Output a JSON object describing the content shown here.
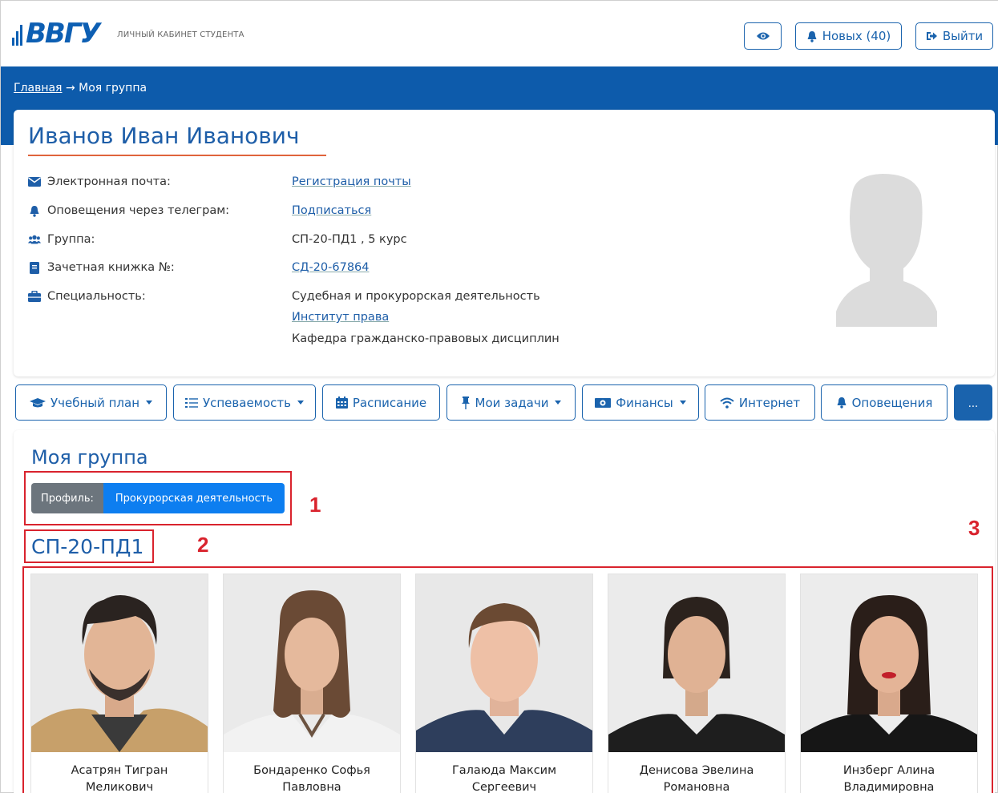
{
  "header": {
    "logo_text": "ВВГУ",
    "subtitle": "ЛИЧНЫЙ КАБИНЕТ СТУДЕНТА",
    "eye_icon": "eye-icon",
    "notifications_label": "Новых (40)",
    "logout_label": "Выйти"
  },
  "breadcrumb": {
    "home": "Главная",
    "arrow": "→",
    "current": "Моя группа"
  },
  "profile": {
    "name": "Иванов Иван Иванович",
    "rows": [
      {
        "icon": "envelope-icon",
        "label": "Электронная почта:",
        "value": "Регистрация почты"
      },
      {
        "icon": "bell-icon",
        "label": "Оповещения через телеграм:",
        "value": "Подписаться"
      },
      {
        "icon": "users-icon",
        "label": "Группа:",
        "value": "СП-20-ПД1 , 5 курс"
      },
      {
        "icon": "book-icon",
        "label": "Зачетная книжка №:",
        "value": "СД-20-67864"
      },
      {
        "icon": "briefcase-icon",
        "label": "Специальность:",
        "value": "Судебная и прокурорская деятельность"
      }
    ],
    "institute": "Институт права",
    "department": "Кафедра гражданско-правовых дисциплин"
  },
  "nav": [
    {
      "icon": "graduation-cap-icon",
      "label": "Учебный план",
      "dropdown": true
    },
    {
      "icon": "list-icon",
      "label": "Успеваемость",
      "dropdown": true
    },
    {
      "icon": "calendar-icon",
      "label": "Расписание",
      "dropdown": false
    },
    {
      "icon": "pin-icon",
      "label": "Мои задачи",
      "dropdown": true
    },
    {
      "icon": "money-icon",
      "label": "Финансы",
      "dropdown": true
    },
    {
      "icon": "wifi-icon",
      "label": "Интернет",
      "dropdown": false
    },
    {
      "icon": "bell-icon",
      "label": "Оповещения",
      "dropdown": false
    },
    {
      "icon": "",
      "label": "...",
      "dropdown": false
    }
  ],
  "group_page": {
    "title": "Моя группа",
    "profile_label": "Профиль:",
    "profile_value": "Прокурорская деятельность",
    "group_name": "СП-20-ПД1",
    "annotations": [
      "1",
      "2",
      "3"
    ],
    "students": [
      {
        "name_line1": "Асатрян Тигран",
        "name_line2": "Меликович"
      },
      {
        "name_line1": "Бондаренко Софья",
        "name_line2": "Павловна"
      },
      {
        "name_line1": "Галаюда Максим",
        "name_line2": "Сергеевич"
      },
      {
        "name_line1": "Денисова Эвелина",
        "name_line2": "Романовна"
      },
      {
        "name_line1": "Инзберг Алина",
        "name_line2": "Владимировна"
      }
    ]
  },
  "colors": {
    "brand_blue": "#0d5bab",
    "link_blue": "#1e5ea8",
    "annotation_red": "#d9232d",
    "badge_grey": "#6c757d",
    "badge_blue": "#0d7ef0"
  }
}
